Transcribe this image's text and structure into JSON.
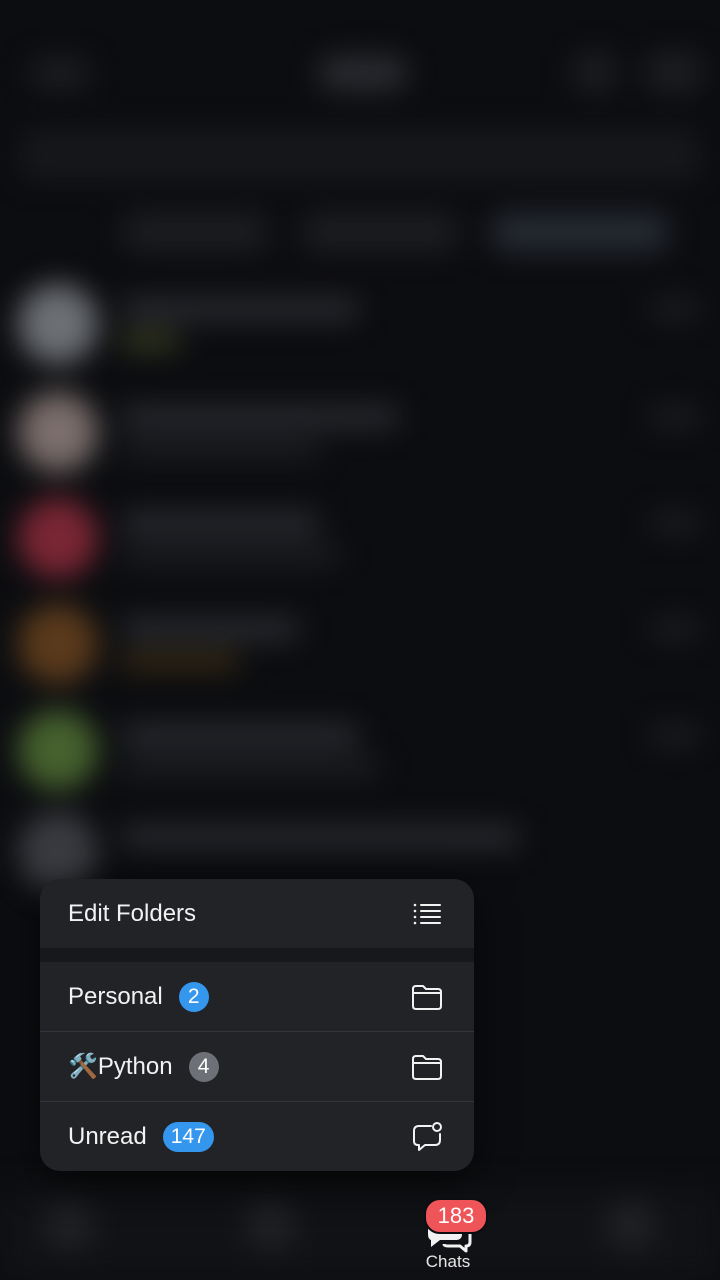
{
  "menu": {
    "edit_folders": "Edit Folders",
    "items": [
      {
        "label": "Personal",
        "count": "2",
        "icon": "folder-icon"
      },
      {
        "label": "🛠️Python",
        "count": "4",
        "icon": "folder-icon"
      },
      {
        "label": "Unread",
        "count": "147",
        "icon": "unread-chat-icon"
      }
    ]
  },
  "tabbar": {
    "chats_label": "Chats",
    "chats_badge": "183"
  },
  "colors": {
    "badge_blue": "#3596ee",
    "badge_gray": "#6d7076",
    "badge_red": "#ef5458",
    "menu_bg": "#212327"
  }
}
